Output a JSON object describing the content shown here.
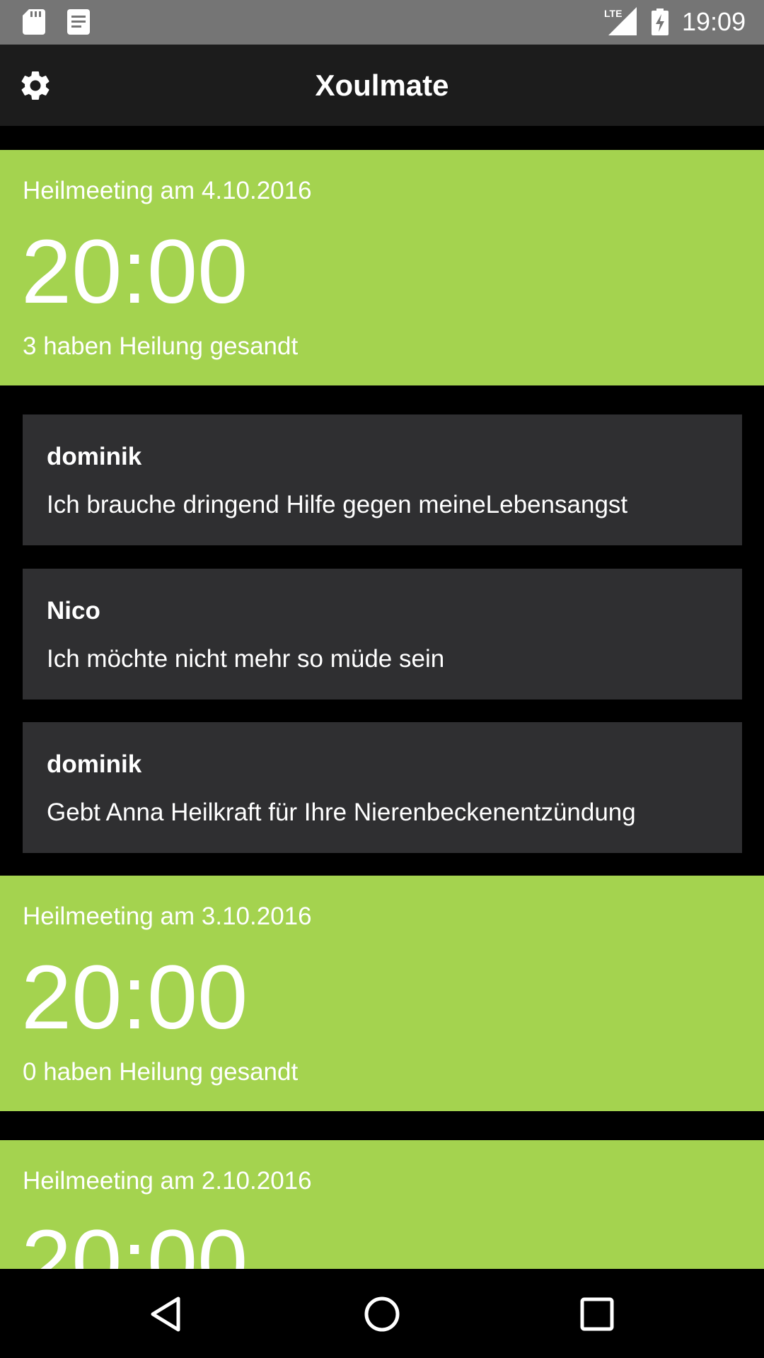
{
  "status_bar": {
    "time": "19:09",
    "network": "LTE",
    "icons": [
      "sd-card-icon",
      "notes-icon",
      "lte-signal-icon",
      "battery-charging-icon"
    ]
  },
  "app_bar": {
    "title": "Xoulmate",
    "settings_icon": "gear-icon"
  },
  "meetings": [
    {
      "date_label": "Heilmeeting am 4.10.2016",
      "time": "20:00",
      "count_label": "3 haben Heilung gesandt",
      "messages": [
        {
          "author": "dominik",
          "text": "Ich brauche dringend Hilfe gegen meineLebensangst"
        },
        {
          "author": "Nico",
          "text": "Ich möchte nicht mehr so müde sein"
        },
        {
          "author": "dominik",
          "text": "Gebt Anna Heilkraft für Ihre Nierenbeckenentzündung"
        }
      ]
    },
    {
      "date_label": "Heilmeeting am 3.10.2016",
      "time": "20:00",
      "count_label": "0 haben Heilung gesandt",
      "messages": []
    },
    {
      "date_label": "Heilmeeting am 2.10.2016",
      "time": "20:00",
      "count_label": "",
      "messages": []
    }
  ],
  "nav_bar": {
    "icons": [
      "back-icon",
      "home-icon",
      "recents-icon"
    ]
  },
  "colors": {
    "status_bar": "#757575",
    "app_bar": "#1c1c1c",
    "meeting_card": "#a4d34f",
    "message_card": "#2f2f31",
    "background": "#000000"
  }
}
